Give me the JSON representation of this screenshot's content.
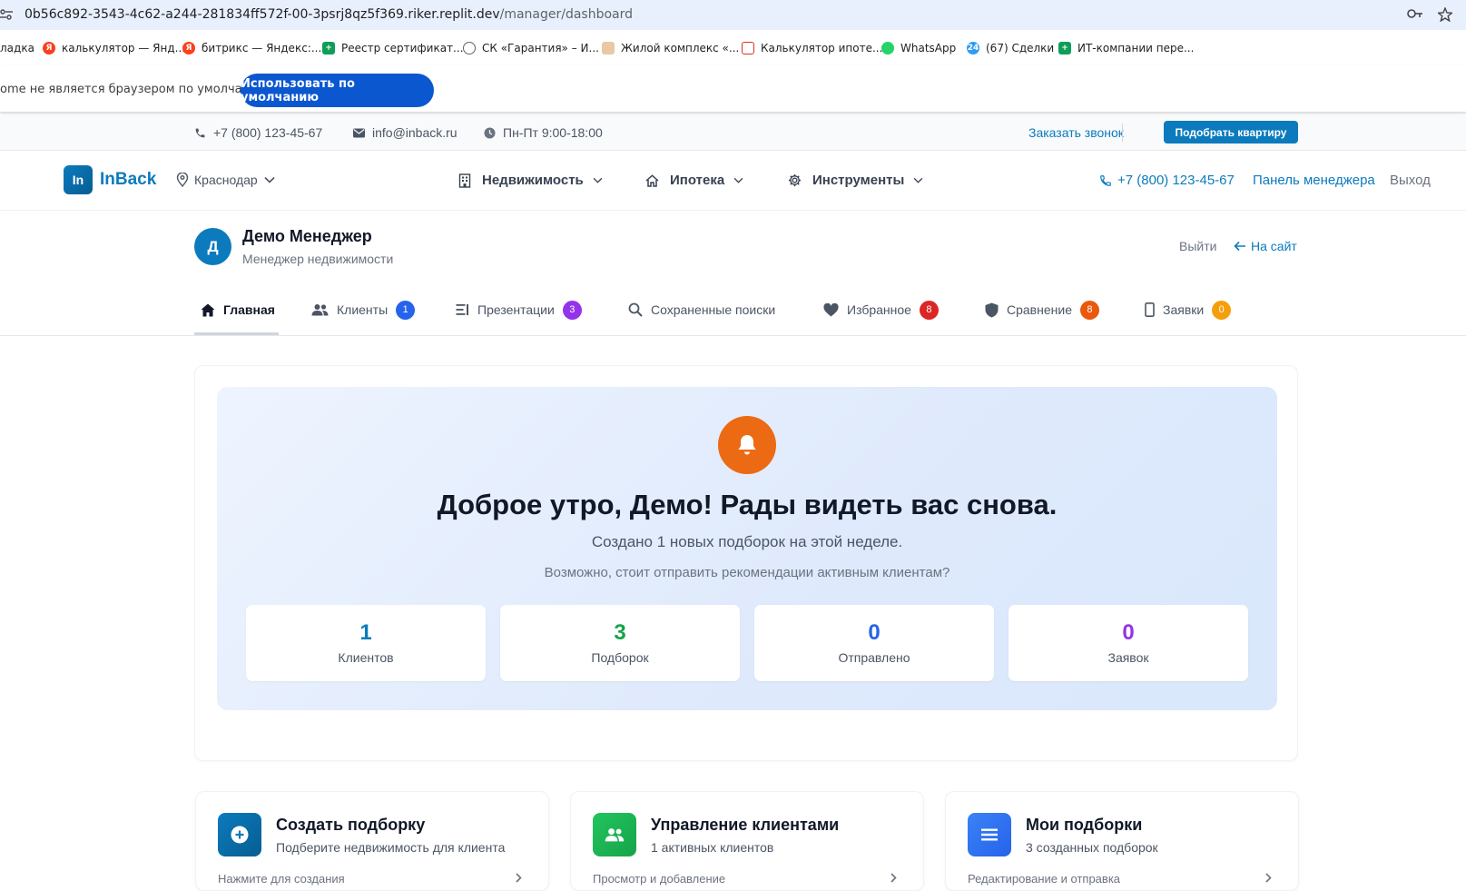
{
  "browser": {
    "url_host": "0b56c892-3543-4c62-a244-281834ff572f-00-3psrj8qz5f369.riker.replit.dev",
    "url_path": "/manager/dashboard",
    "bookmarks": [
      {
        "label": "ладка",
        "icon": "none"
      },
      {
        "label": "калькулятор — Янд...",
        "icon": "yandex-icon",
        "color": "#fc3f1d"
      },
      {
        "label": "битрикс — Яндекс:...",
        "icon": "yandex-icon",
        "color": "#fc3f1d"
      },
      {
        "label": "Реестр сертификат...",
        "icon": "sheets-icon",
        "color": "#0f9d58"
      },
      {
        "label": "СК «Гарантия» – И...",
        "icon": "globe-icon",
        "color": "#5f6368"
      },
      {
        "label": "Жилой комплекс «...",
        "icon": "building-icon",
        "color": "#c08a5b"
      },
      {
        "label": "Калькулятор ипоте...",
        "icon": "calculator-icon",
        "color": "#d93025"
      },
      {
        "label": "WhatsApp",
        "icon": "whatsapp-icon",
        "color": "#25d366"
      },
      {
        "label": "(67) Сделки",
        "icon": "bitrix-icon",
        "color": "#2d9cf4"
      },
      {
        "label": "ИТ-компании пере...",
        "icon": "sheets-icon",
        "color": "#0f9d58"
      }
    ],
    "default_message": "ome не является браузером по умолчанию.",
    "default_button": "Использовать по умолчанию"
  },
  "topbar": {
    "phone": "+7 (800) 123-45-67",
    "email": "info@inback.ru",
    "hours": "Пн-Пт 9:00-18:00",
    "callback": "Заказать звонок",
    "pick_button": "Подобрать квартиру"
  },
  "nav": {
    "logo_mark": "In",
    "brand": "InBack",
    "city": "Краснодар",
    "menus": [
      {
        "label": "Недвижимость",
        "icon": "building-icon"
      },
      {
        "label": "Ипотека",
        "icon": "home-icon"
      },
      {
        "label": "Инструменты",
        "icon": "gear-icon"
      }
    ],
    "phone": "+7 (800) 123-45-67",
    "manager_panel": "Панель менеджера",
    "exit": "Выход"
  },
  "profile": {
    "initial": "Д",
    "name": "Демо Менеджер",
    "role": "Менеджер недвижимости",
    "logout": "Выйти",
    "to_site": "На сайт"
  },
  "tabs": [
    {
      "label": "Главная",
      "icon": "home-icon",
      "badge": null
    },
    {
      "label": "Клиенты",
      "icon": "users-icon",
      "badge": "1",
      "badge_color": "#2563eb"
    },
    {
      "label": "Презентации",
      "icon": "presentation-icon",
      "badge": "3",
      "badge_color": "#9333ea"
    },
    {
      "label": "Сохраненные поиски",
      "icon": "search-icon",
      "badge": null
    },
    {
      "label": "Избранное",
      "icon": "heart-icon",
      "badge": "8",
      "badge_color": "#dc2626"
    },
    {
      "label": "Сравнение",
      "icon": "shield-icon",
      "badge": "8",
      "badge_color": "#ea580c"
    },
    {
      "label": "Заявки",
      "icon": "phone-icon",
      "badge": "0",
      "badge_color": "#f59e0b"
    }
  ],
  "welcome": {
    "greeting": "Доброе утро, Демо! Рады видеть вас снова.",
    "subtitle": "Создано 1 новых подборок на этой неделе.",
    "hint": "Возможно, стоит отправить рекомендации активным клиентам?",
    "stats": [
      {
        "value": "1",
        "label": "Клиентов",
        "color": "#0c7bbd"
      },
      {
        "value": "3",
        "label": "Подборок",
        "color": "#16a34a"
      },
      {
        "value": "0",
        "label": "Отправлено",
        "color": "#2563eb"
      },
      {
        "value": "0",
        "label": "Заявок",
        "color": "#9333ea"
      }
    ]
  },
  "actions": [
    {
      "title": "Создать подборку",
      "subtitle": "Подберите недвижимость для клиента",
      "link": "Нажмите для создания",
      "icon": "plus-circle-icon",
      "color": "#0c7bbd"
    },
    {
      "title": "Управление клиентами",
      "subtitle": "1 активных клиентов",
      "link": "Просмотр и добавление",
      "icon": "users-icon",
      "color": "#16a34a"
    },
    {
      "title": "Мои подборки",
      "subtitle": "3 созданных подборок",
      "link": "Редактирование и отправка",
      "icon": "list-icon",
      "color": "#2563eb"
    }
  ]
}
